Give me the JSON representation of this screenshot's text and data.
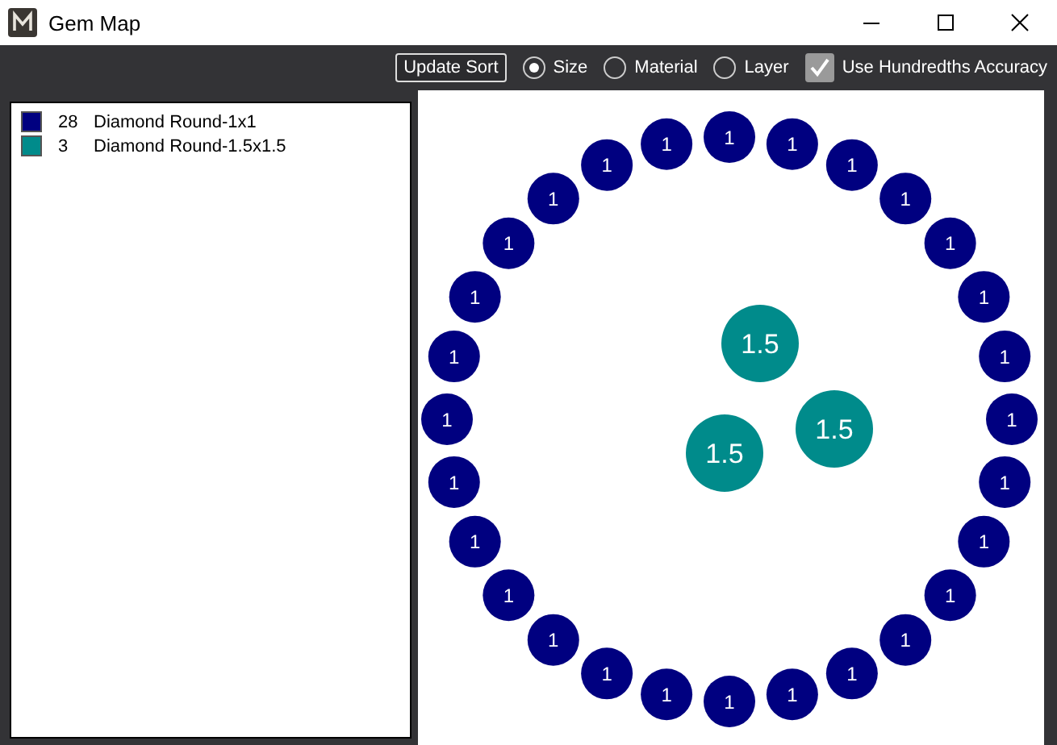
{
  "window": {
    "title": "Gem Map"
  },
  "toolbar": {
    "update_button": "Update Sort",
    "sort_options": [
      {
        "label": "Size",
        "selected": true
      },
      {
        "label": "Material",
        "selected": false
      },
      {
        "label": "Layer",
        "selected": false
      }
    ],
    "accuracy": {
      "label": "Use Hundredths Accuracy",
      "checked": true
    }
  },
  "gem_groups": [
    {
      "count": "28",
      "name": "Diamond Round-1x1",
      "color": "#000080",
      "kind": "ring",
      "gems": [
        "1",
        "1",
        "1",
        "1",
        "1",
        "1",
        "1",
        "1",
        "1",
        "1",
        "1",
        "1",
        "1",
        "1",
        "1",
        "1",
        "1",
        "1",
        "1",
        "1",
        "1",
        "1",
        "1",
        "1",
        "1",
        "1",
        "1",
        "1"
      ]
    },
    {
      "count": "3",
      "name": "Diamond Round-1.5x1.5",
      "color": "#008b8b",
      "kind": "cluster",
      "gems": [
        "1.5",
        "1.5",
        "1.5"
      ]
    }
  ]
}
